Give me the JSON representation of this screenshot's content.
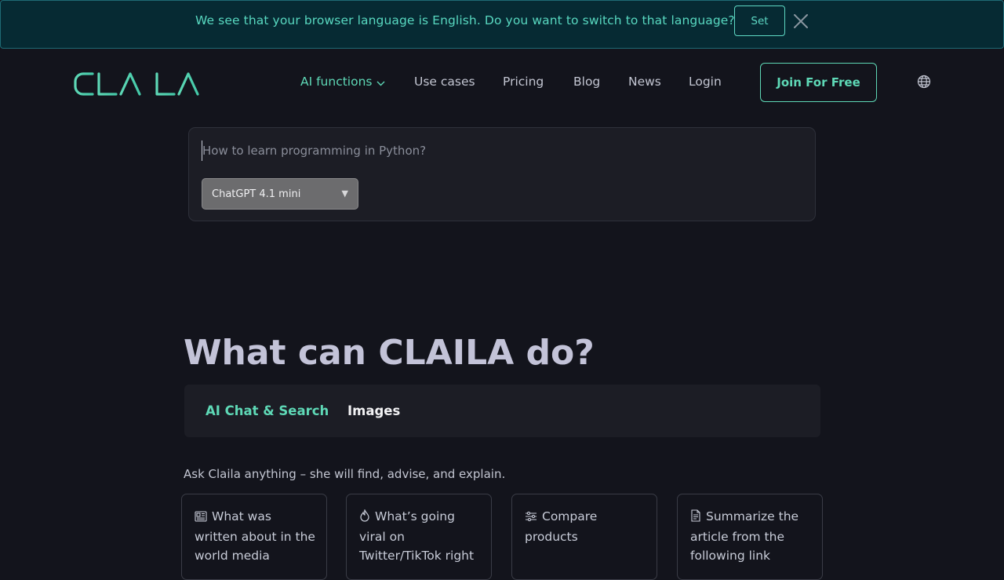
{
  "banner": {
    "message": "We see that your browser language is English. Do you want to switch to that language?",
    "set_label": "Set"
  },
  "nav": {
    "logo_text": "CLAILA",
    "links": [
      {
        "label": "AI functions",
        "active": true,
        "dropdown": true
      },
      {
        "label": "Use cases"
      },
      {
        "label": "Pricing"
      },
      {
        "label": "Blog"
      },
      {
        "label": "News"
      },
      {
        "label": "Login"
      }
    ],
    "cta_label": "Join For Free",
    "language_icon": "globe-icon"
  },
  "prompt": {
    "placeholder": "How to learn programming in Python?",
    "value": "",
    "model_selected": "ChatGPT 4.1 mini"
  },
  "features": {
    "title": "What can CLAILA do?",
    "tabs": [
      {
        "label": "AI Chat & Search",
        "active": true
      },
      {
        "label": "Images",
        "active": false
      }
    ],
    "subtitle": "Ask Claila anything – she will find, advise, and explain.",
    "suggestions": [
      {
        "icon": "newspaper-icon",
        "text": "What was written about in the world media"
      },
      {
        "icon": "flame-icon",
        "text": "What’s going viral on Twitter/TikTok right"
      },
      {
        "icon": "sliders-icon",
        "text": "Compare products"
      },
      {
        "icon": "document-icon",
        "text": "Summarize the article from the following link"
      }
    ]
  },
  "colors": {
    "accent": "#5ed8b6",
    "background": "#13141c",
    "banner_bg": "#062a33"
  }
}
